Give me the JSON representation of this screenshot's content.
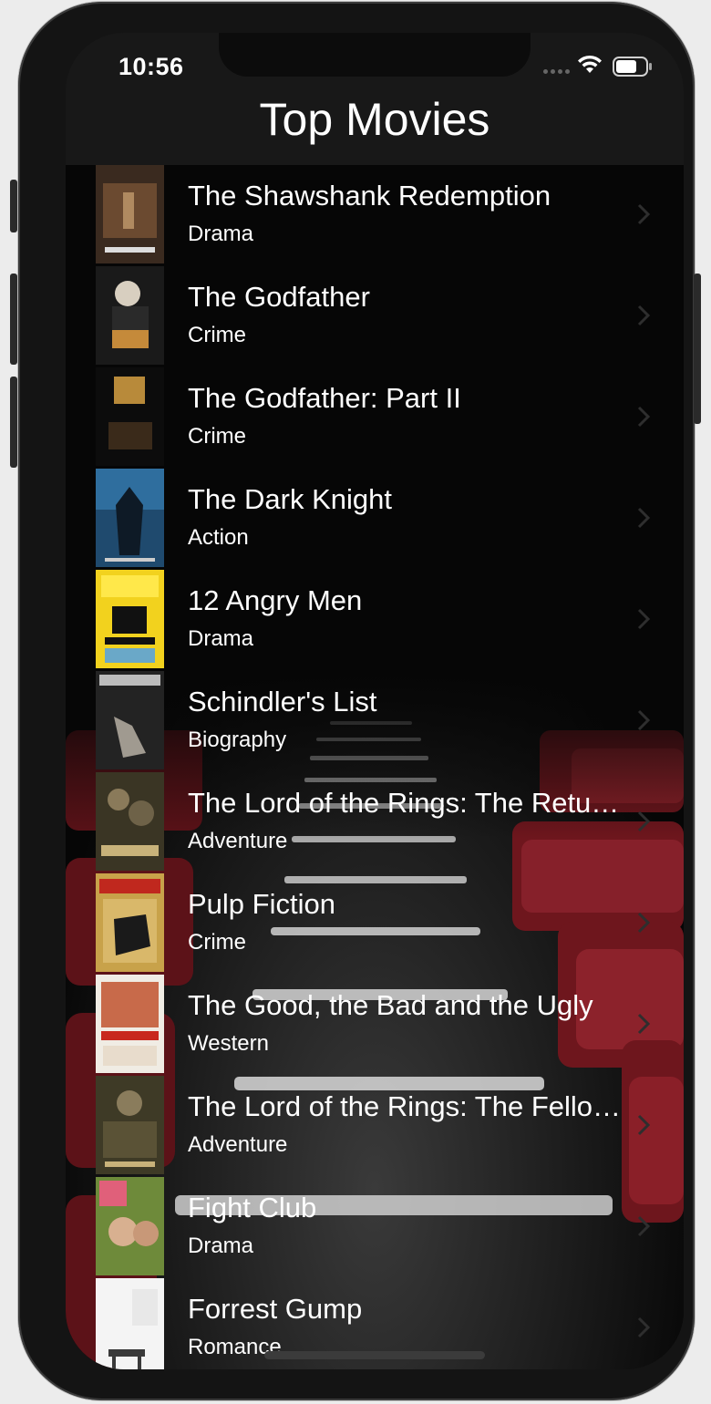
{
  "status": {
    "time": "10:56"
  },
  "nav": {
    "title": "Top Movies"
  },
  "movies": [
    {
      "title": "The Shawshank Redemption",
      "genre": "Drama"
    },
    {
      "title": "The Godfather",
      "genre": "Crime"
    },
    {
      "title": "The Godfather: Part II",
      "genre": "Crime"
    },
    {
      "title": "The Dark Knight",
      "genre": "Action"
    },
    {
      "title": "12 Angry Men",
      "genre": "Drama"
    },
    {
      "title": "Schindler's List",
      "genre": "Biography"
    },
    {
      "title": "The Lord of the Rings: The Retur…",
      "genre": "Adventure"
    },
    {
      "title": "Pulp Fiction",
      "genre": "Crime"
    },
    {
      "title": "The Good, the Bad and the Ugly",
      "genre": "Western"
    },
    {
      "title": "The Lord of the Rings: The Fello…",
      "genre": "Adventure"
    },
    {
      "title": "Fight Club",
      "genre": "Drama"
    },
    {
      "title": "Forrest Gump",
      "genre": "Romance"
    }
  ],
  "icons": {
    "poster": "movie-poster-icon",
    "chevron": "chevron-right-icon",
    "wifi": "wifi-icon",
    "battery": "battery-icon",
    "signal": "cellular-signal-icon"
  },
  "colors": {
    "background": "#060606",
    "seat_red": "#7a1a20",
    "text": "#ffffff"
  }
}
